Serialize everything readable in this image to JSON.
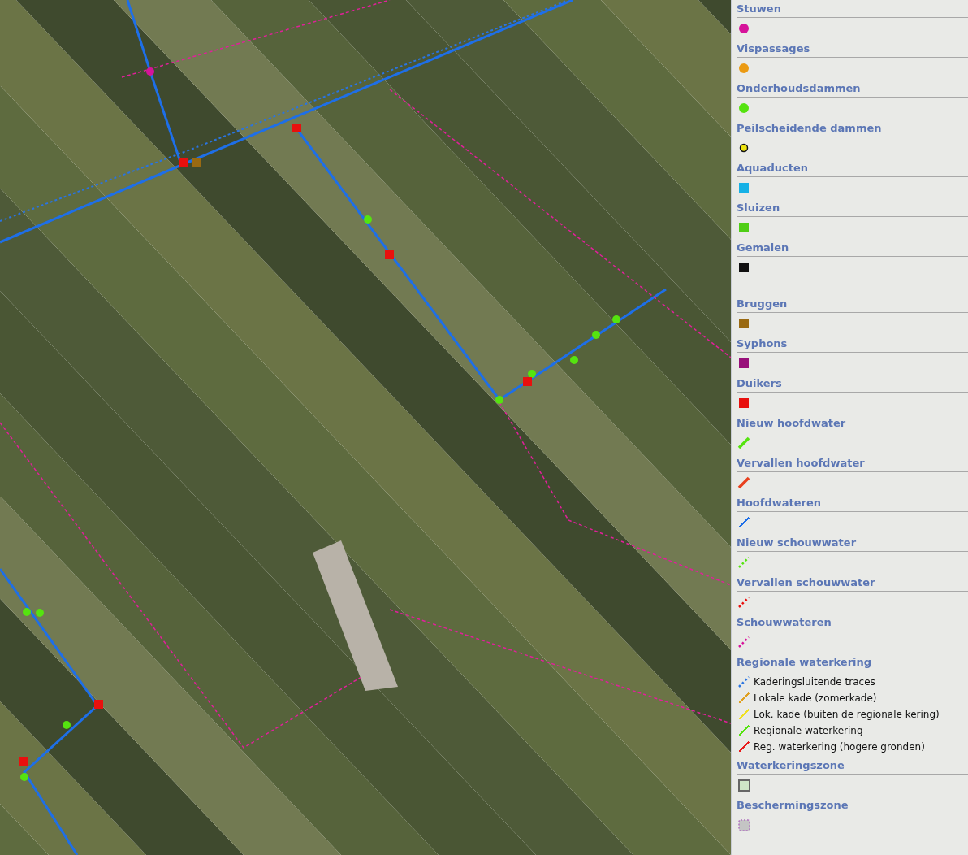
{
  "legend": {
    "sections": [
      {
        "title": "Stuwen",
        "symbols": [
          {
            "kind": "circle",
            "color": "#d6139a"
          }
        ]
      },
      {
        "title": "Vispassages",
        "symbols": [
          {
            "kind": "circle",
            "color": "#eb9a12"
          }
        ]
      },
      {
        "title": "Onderhoudsdammen",
        "symbols": [
          {
            "kind": "circle",
            "color": "#55e30f"
          }
        ]
      },
      {
        "title": "Peilscheidende dammen",
        "symbols": [
          {
            "kind": "ring",
            "color": "#ece311"
          }
        ]
      },
      {
        "title": "Aquaducten",
        "symbols": [
          {
            "kind": "square",
            "color": "#16b1e6"
          }
        ]
      },
      {
        "title": "Sluizen",
        "symbols": [
          {
            "kind": "square",
            "color": "#4fce15"
          }
        ]
      },
      {
        "title": "Gemalen",
        "symbols": [
          {
            "kind": "square",
            "color": "#111111"
          }
        ]
      },
      {
        "title": "Bruggen",
        "symbols": [
          {
            "kind": "square",
            "color": "#9a6a12"
          }
        ]
      },
      {
        "title": "Syphons",
        "symbols": [
          {
            "kind": "square",
            "color": "#980f7a"
          }
        ]
      },
      {
        "title": "Duikers",
        "symbols": [
          {
            "kind": "square",
            "color": "#e8100e"
          }
        ]
      },
      {
        "title": "Nieuw hoofdwater",
        "symbols": [
          {
            "kind": "line",
            "color": "#55e30f"
          }
        ]
      },
      {
        "title": "Vervallen hoofdwater",
        "symbols": [
          {
            "kind": "line",
            "color": "#e8401e"
          }
        ]
      },
      {
        "title": "Hoofdwateren",
        "symbols": [
          {
            "kind": "thin-line",
            "color": "#1e6fe8"
          }
        ]
      },
      {
        "title": "Nieuw schouwwater",
        "symbols": [
          {
            "kind": "dotted-line",
            "color": "#55e30f"
          }
        ]
      },
      {
        "title": "Vervallen schouwwater",
        "symbols": [
          {
            "kind": "dotted-line",
            "color": "#e8100e"
          }
        ]
      },
      {
        "title": "Schouwwateren",
        "symbols": [
          {
            "kind": "dotted-line",
            "color": "#d6139a"
          }
        ]
      },
      {
        "title": "Regionale waterkering",
        "symbols": [
          {
            "kind": "dotted-line",
            "color": "#2a74e0",
            "label": "Kaderingsluitende traces"
          },
          {
            "kind": "thin-line",
            "color": "#e0a020",
            "label": "Lokale kade (zomerkade)"
          },
          {
            "kind": "thin-line",
            "color": "#f0e020",
            "label": "Lok. kade (buiten de regionale kering)"
          },
          {
            "kind": "thin-line",
            "color": "#55e30f",
            "label": "Regionale waterkering"
          },
          {
            "kind": "thin-line",
            "color": "#e81c1c",
            "label": "Reg. waterkering (hogere gronden)"
          }
        ]
      },
      {
        "title": "Waterkeringszone",
        "symbols": [
          {
            "kind": "outlined-square",
            "color": "#cfe6c8"
          }
        ]
      },
      {
        "title": "Beschermingszone",
        "symbols": [
          {
            "kind": "dashed-square",
            "color": "#c4c4c4"
          }
        ]
      }
    ]
  }
}
